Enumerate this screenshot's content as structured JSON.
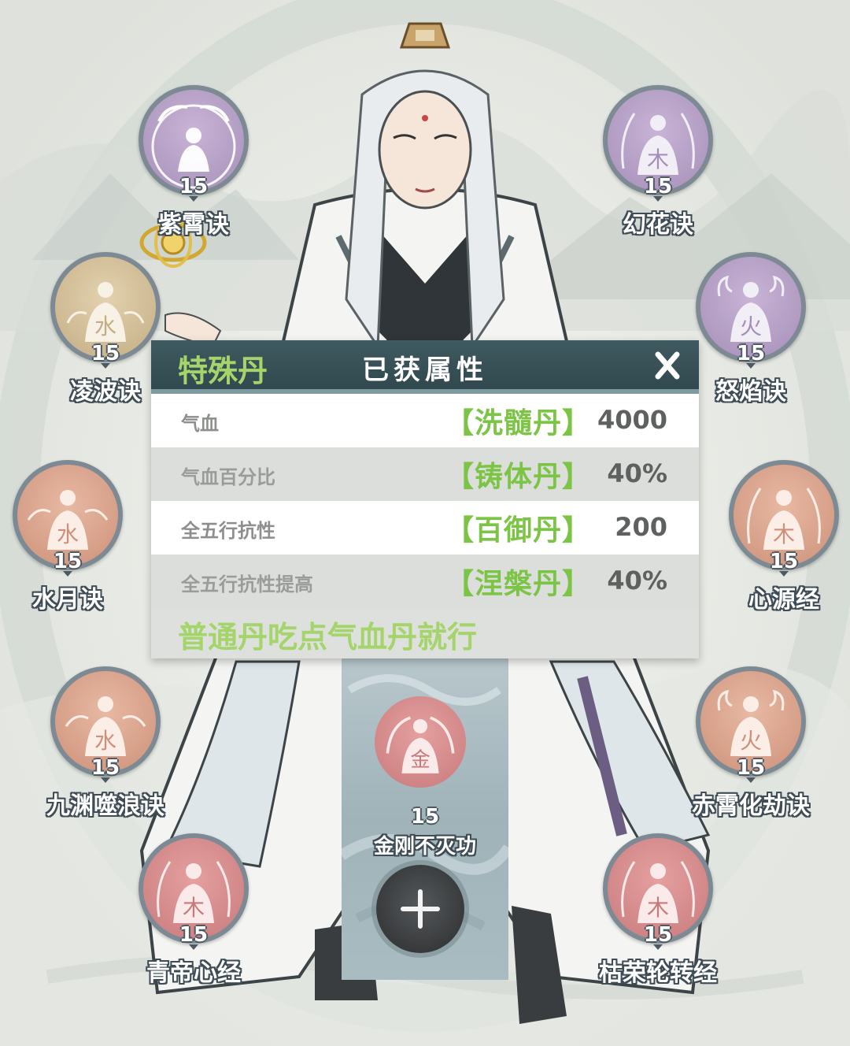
{
  "skills": [
    {
      "name": "紫霄诀",
      "level": "15",
      "color": "purple",
      "glyph": ""
    },
    {
      "name": "幻花诀",
      "level": "15",
      "color": "purple",
      "glyph": "木"
    },
    {
      "name": "凌波诀",
      "level": "15",
      "color": "gold",
      "glyph": "水"
    },
    {
      "name": "怒焰诀",
      "level": "15",
      "color": "purple",
      "glyph": "火"
    },
    {
      "name": "水月诀",
      "level": "15",
      "color": "salmon",
      "glyph": "水"
    },
    {
      "name": "心源经",
      "level": "15",
      "color": "salmon",
      "glyph": "木"
    },
    {
      "name": "九渊噬浪诀",
      "level": "15",
      "color": "salmon",
      "glyph": "水"
    },
    {
      "name": "赤霄化劫诀",
      "level": "15",
      "color": "salmon",
      "glyph": "火"
    },
    {
      "name": "青帝心经",
      "level": "15",
      "color": "red",
      "glyph": "木"
    },
    {
      "name": "枯荣轮转经",
      "level": "15",
      "color": "red",
      "glyph": "木"
    }
  ],
  "center_skill": {
    "name": "金刚不灭功",
    "level": "15",
    "glyph": "金"
  },
  "popup": {
    "tab": "特殊丹",
    "title": "已获属性",
    "close": "X",
    "rows": [
      {
        "label": "气血",
        "pill": "【洗髓丹】",
        "value": "4000"
      },
      {
        "label": "气血百分比",
        "pill": "【铸体丹】",
        "value": "40%"
      },
      {
        "label": "全五行抗性",
        "pill": "【百御丹】",
        "value": "200"
      },
      {
        "label": "全五行抗性提高",
        "pill": "【涅槃丹】",
        "value": "40%"
      }
    ],
    "note": "普通丹吃点气血丹就行"
  },
  "colors": {
    "green_accent": "#7cc445",
    "header": "#2f474d",
    "purple": "#b7a1c9",
    "salmon": "#dca58e",
    "red": "#d68d8d",
    "gold": "#d4c09a"
  }
}
